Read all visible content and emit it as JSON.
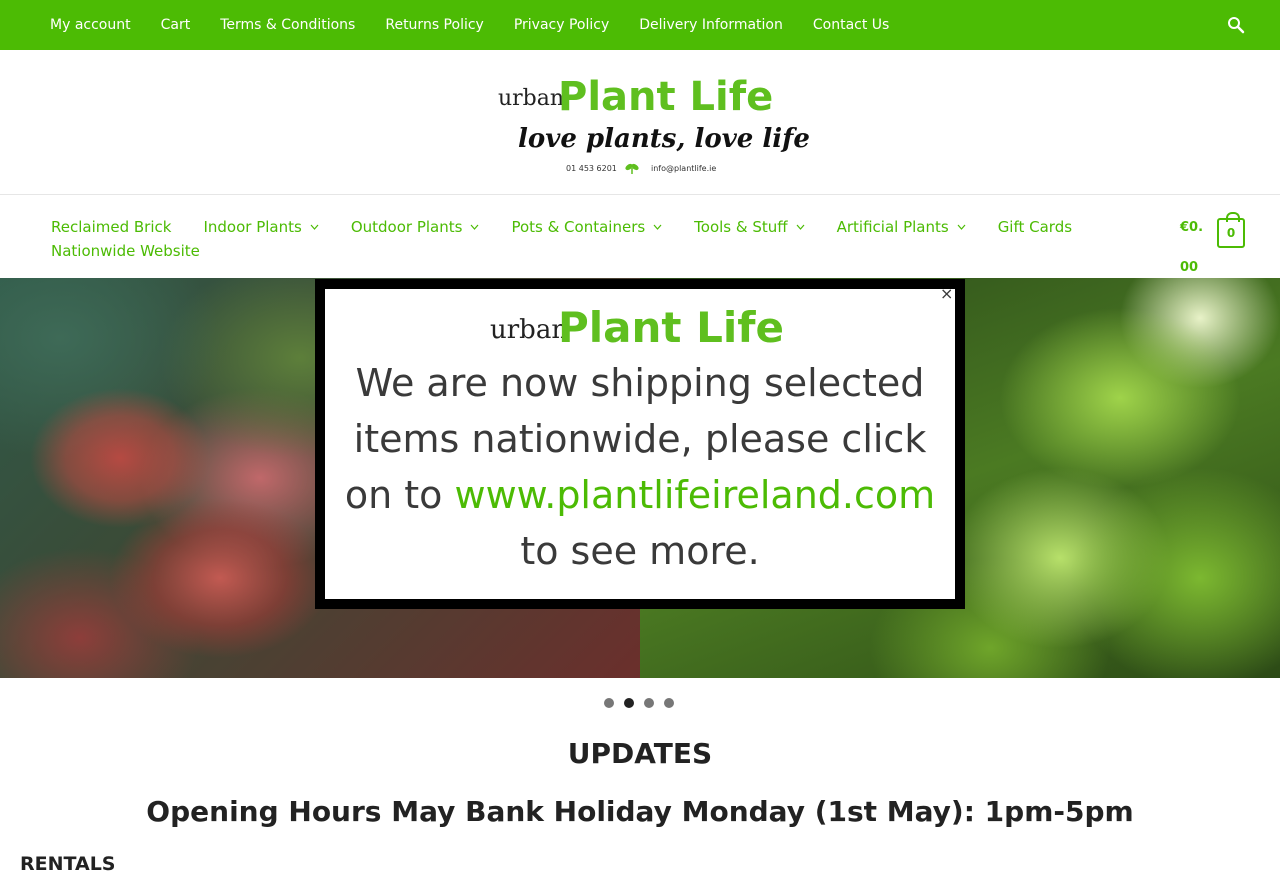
{
  "topbar": {
    "links": [
      "My account",
      "Cart",
      "Terms & Conditions",
      "Returns Policy",
      "Privacy Policy",
      "Delivery Information",
      "Contact Us"
    ],
    "search_icon": "search-icon"
  },
  "logo": {
    "urban": "urban",
    "plantlife": "Plant Life",
    "tagline": "love plants, love life",
    "phone": "01 453 6201",
    "email": "info@plantlife.ie"
  },
  "nav": {
    "items": [
      {
        "label": "Reclaimed Brick",
        "dropdown": false
      },
      {
        "label": "Indoor Plants",
        "dropdown": true
      },
      {
        "label": "Outdoor Plants",
        "dropdown": true
      },
      {
        "label": "Pots & Containers",
        "dropdown": true
      },
      {
        "label": "Tools & Stuff",
        "dropdown": true
      },
      {
        "label": "Artificial Plants",
        "dropdown": true
      },
      {
        "label": "Gift Cards",
        "dropdown": false
      },
      {
        "label": "Nationwide Website",
        "dropdown": false
      }
    ],
    "cart_total": "€0.00",
    "cart_count": "0"
  },
  "popup": {
    "logo_urban": "urban",
    "logo_plantlife": "Plant Life",
    "message_before": "We are now shipping selected items nationwide,  please click on to ",
    "link_text": "www.plantlifeireland.com",
    "message_after": " to see more.",
    "close_label": "×"
  },
  "slider": {
    "slide_count": 4,
    "active_index": 1
  },
  "content": {
    "updates_heading": "UPDATES",
    "hours_heading": "Opening Hours May Bank Holiday Monday (1st May): 1pm-5pm",
    "rentals_heading": "RENTALS"
  },
  "colors": {
    "brand_green": "#4cbb04",
    "logo_green": "#5fbf1f"
  }
}
